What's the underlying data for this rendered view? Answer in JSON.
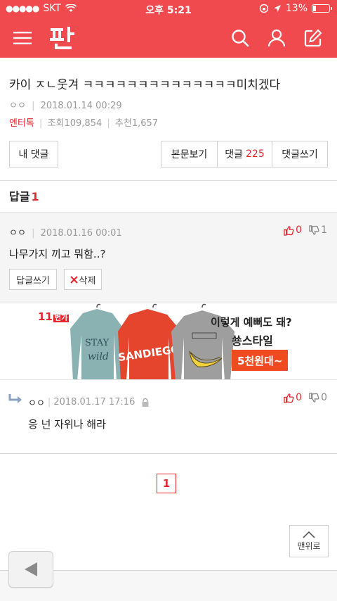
{
  "status": {
    "carrier": "SKT",
    "time": "오후 5:21",
    "battery": "13%"
  },
  "post": {
    "title": "카이 ㅈㄴ웃겨 ㅋㅋㅋㅋㅋㅋㅋㅋㅋㅋㅋㅋㅋㅋ미치겠다",
    "author": "ㅇㅇ",
    "date": "2018.01.14 00:29",
    "category": "엔터톡",
    "views": "조회109,854",
    "recommend": "추천1,657"
  },
  "actions": {
    "my_comments": "내 댓글",
    "view_post": "본문보기",
    "comments_label": "댓글",
    "comments_count": "225",
    "write_comment": "댓글쓰기"
  },
  "reply_section": {
    "label": "답글",
    "count": "1"
  },
  "comment": {
    "author": "ㅇㅇ",
    "date": "2018.01.16 00:01",
    "upvotes": "0",
    "downvotes": "1",
    "text": "나무가지 끼고 뭐함..?",
    "reply_button": "답글쓰기",
    "delete_button": "삭제"
  },
  "ad": {
    "brand": "11",
    "brand_small": "번가",
    "line1": "이렇게 예뻐도 돼?",
    "line2": "쑝스타일",
    "tag": "5천원대~",
    "shirt_text_1": "STAY",
    "shirt_text_2": "wild",
    "shirt_text_3": "SANDIEGO"
  },
  "subcomment": {
    "author": "ㅇㅇ",
    "date": "2018.01.17 17:16",
    "upvotes": "0",
    "downvotes": "0",
    "text": "응 넌 자위나 해라"
  },
  "pagination": {
    "current": "1"
  },
  "to_top": "맨위로",
  "colors": {
    "brand": "#f04a4f",
    "accent": "#e4282e"
  }
}
